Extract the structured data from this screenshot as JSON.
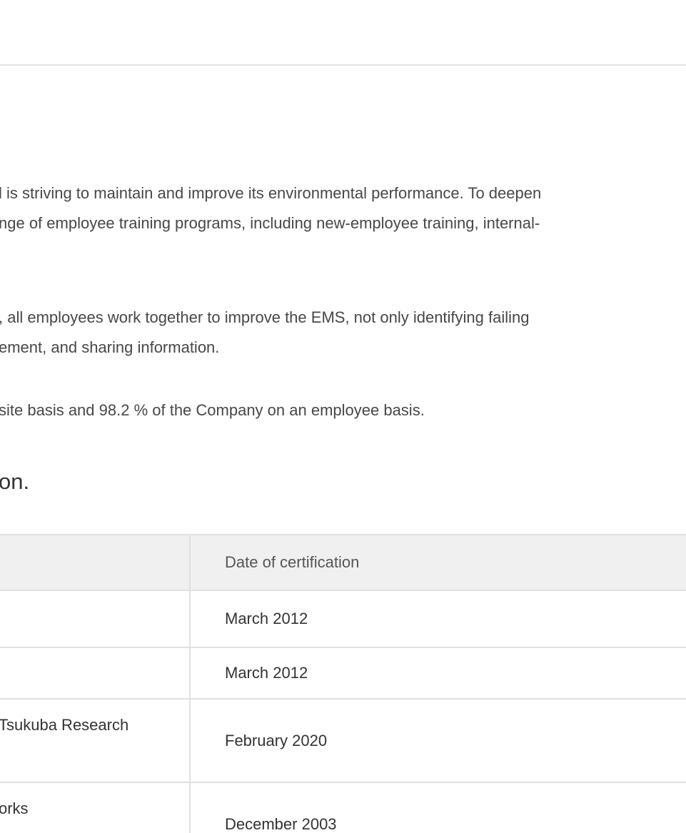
{
  "content": {
    "paragraphs": [
      [
        "l is striving to maintain and improve its environmental performance. To deepen",
        "nge of employee training programs, including new-employee training, internal-"
      ],
      [
        ", all employees work together to improve the EMS, not only identifying failing",
        "ement, and sharing information."
      ],
      [
        "site basis and 98.2 % of the Company on an employee basis."
      ]
    ],
    "section_heading": "on."
  },
  "table": {
    "headers": [
      "",
      "Date of certification"
    ],
    "rows": [
      {
        "site": "",
        "date": "March 2012"
      },
      {
        "site": "",
        "date": "March 2012"
      },
      {
        "site": "Tsukuba Research",
        "date": "February 2020"
      },
      {
        "site": "orks",
        "date": "December 2003"
      }
    ]
  }
}
